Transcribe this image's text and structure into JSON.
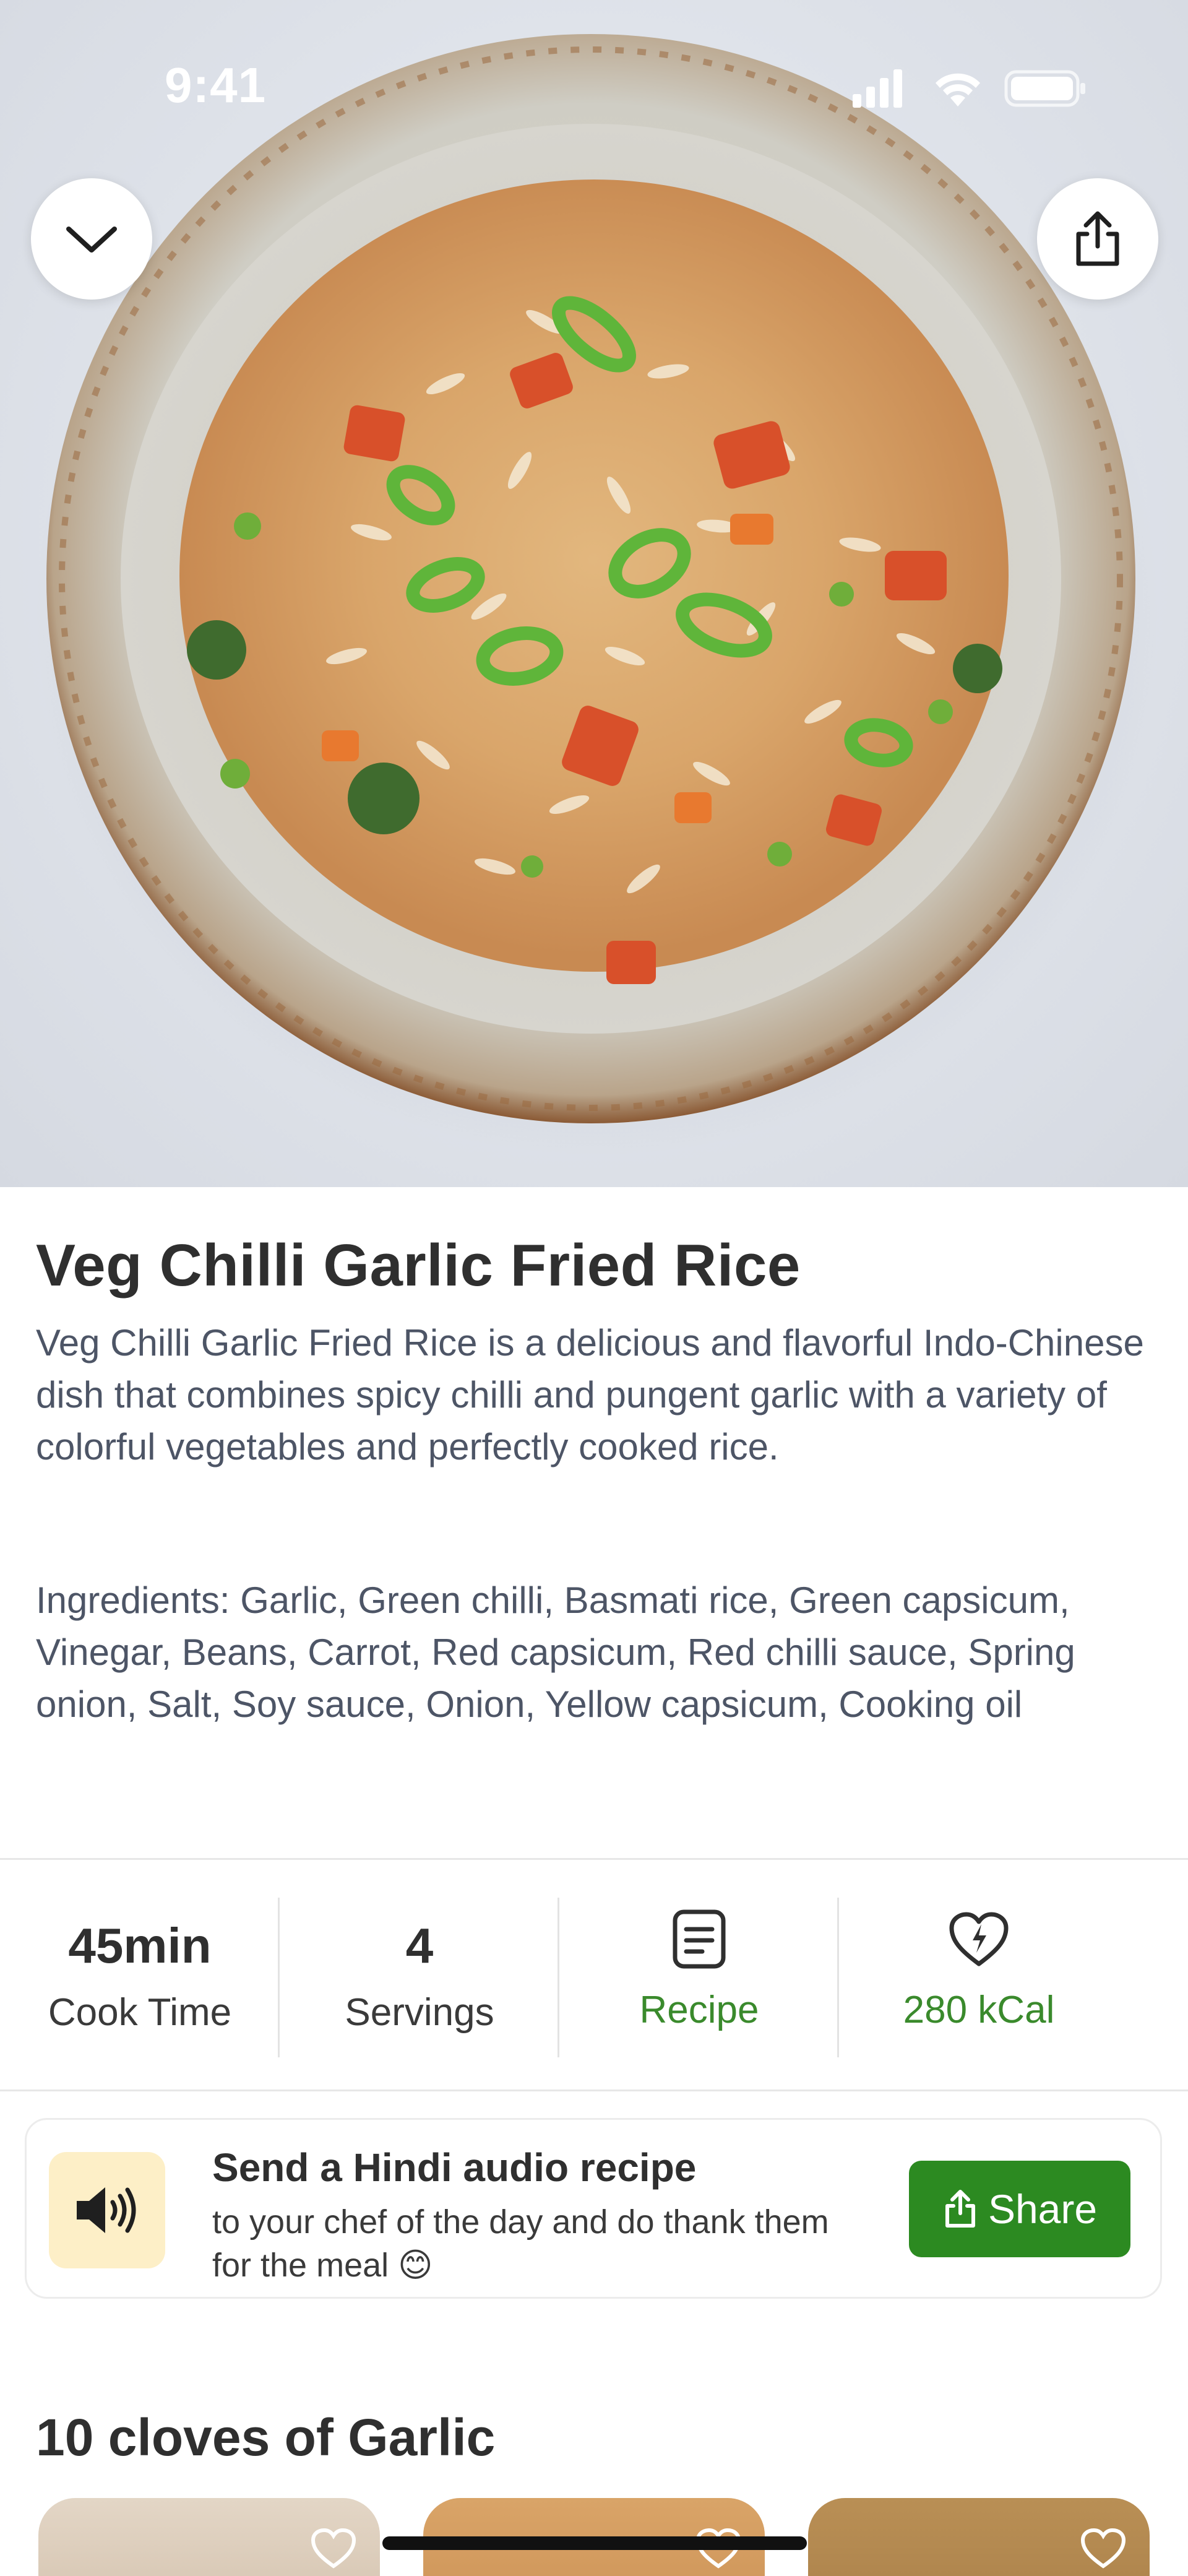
{
  "status_bar": {
    "time": "9:41"
  },
  "hero": {
    "alt": "Bowl of veg chilli garlic fried rice"
  },
  "recipe": {
    "title": "Veg Chilli Garlic Fried Rice",
    "description": "Veg Chilli Garlic Fried Rice is a delicious and flavorful Indo-Chinese dish that combines spicy chilli and pungent garlic with a variety of colorful vegetables and perfectly cooked rice.",
    "ingredients": "Ingredients: Garlic, Green chilli, Basmati rice, Green capsicum, Vinegar, Beans, Carrot, Red capsicum, Red chilli sauce, Spring onion, Salt, Soy sauce, Onion, Yellow capsicum, Cooking oil"
  },
  "stats": {
    "cook_time_value": "45min",
    "cook_time_label": "Cook Time",
    "servings_value": "4",
    "servings_label": "Servings",
    "recipe_label": "Recipe",
    "calories_label": "280 kCal"
  },
  "audio_card": {
    "title": "Send a Hindi audio recipe",
    "subtitle": "to your chef of the day and do thank them for the meal 😊",
    "share_label": "Share"
  },
  "section": {
    "title": "10 cloves of Garlic"
  },
  "colors": {
    "accent_green": "#2c8a21",
    "speaker_tile": "#fdefc7"
  }
}
